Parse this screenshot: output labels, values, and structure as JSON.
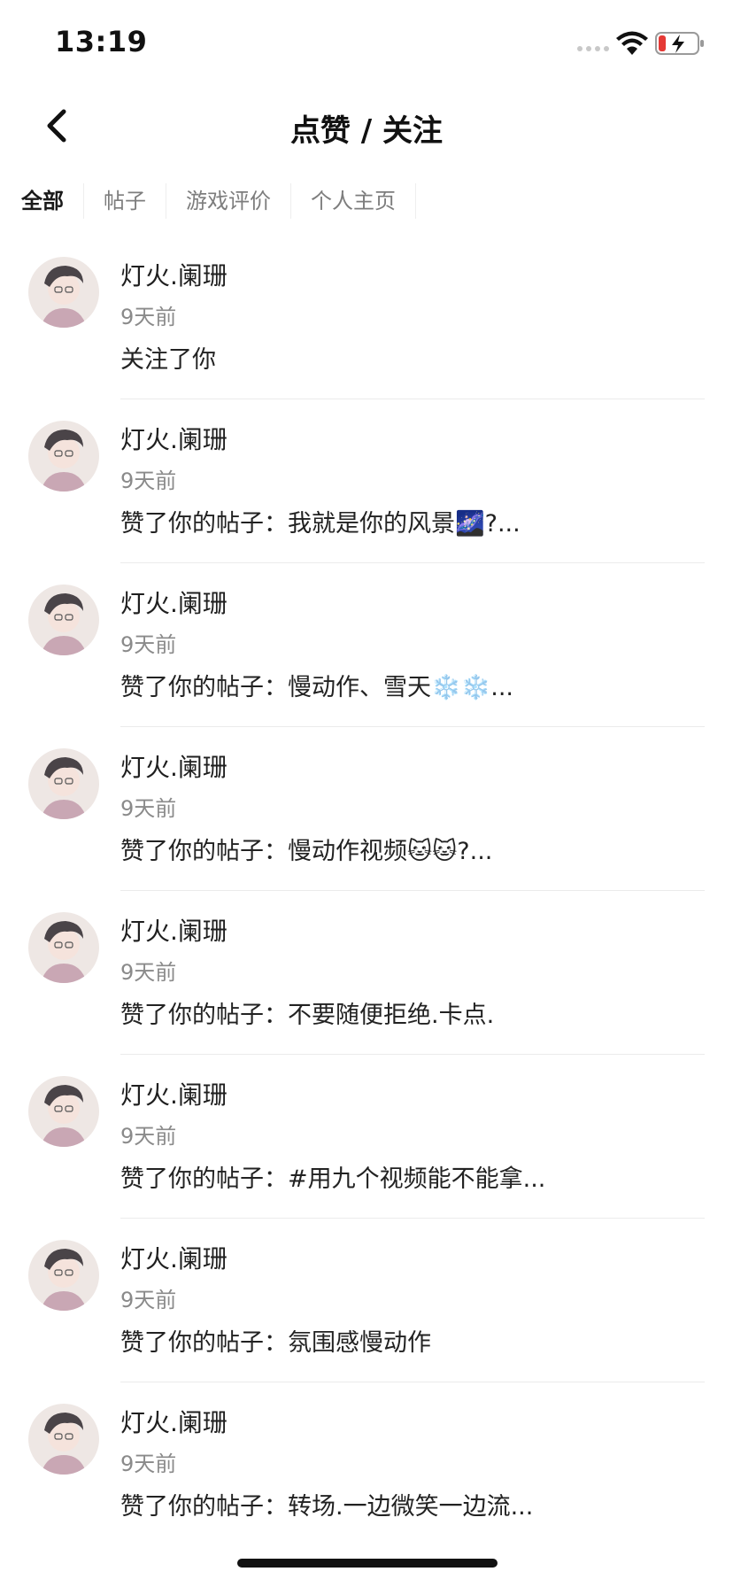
{
  "status_bar": {
    "time": "13:19"
  },
  "header": {
    "title": "点赞 / 关注"
  },
  "tabs": [
    {
      "label": "全部",
      "active": true
    },
    {
      "label": "帖子",
      "active": false
    },
    {
      "label": "游戏评价",
      "active": false
    },
    {
      "label": "个人主页",
      "active": false
    }
  ],
  "notifications": [
    {
      "user": "灯火.阑珊",
      "time": "9天前",
      "message": "关注了你"
    },
    {
      "user": "灯火.阑珊",
      "time": "9天前",
      "message": "赞了你的帖子：我就是你的风景🌌?..."
    },
    {
      "user": "灯火.阑珊",
      "time": "9天前",
      "message": "赞了你的帖子：慢动作、雪天❄️❄️..."
    },
    {
      "user": "灯火.阑珊",
      "time": "9天前",
      "message": "赞了你的帖子：慢动作视频🐱🐱?..."
    },
    {
      "user": "灯火.阑珊",
      "time": "9天前",
      "message": "赞了你的帖子：不要随便拒绝.卡点."
    },
    {
      "user": "灯火.阑珊",
      "time": "9天前",
      "message": "赞了你的帖子：#用九个视频能不能拿..."
    },
    {
      "user": "灯火.阑珊",
      "time": "9天前",
      "message": "赞了你的帖子：氛围感慢动作"
    },
    {
      "user": "灯火.阑珊",
      "time": "9天前",
      "message": "赞了你的帖子：转场.一边微笑一边流..."
    }
  ],
  "colors": {
    "battery_low": "#e53935",
    "text_primary": "#1f1f1f",
    "text_secondary": "#8a8a8a"
  }
}
